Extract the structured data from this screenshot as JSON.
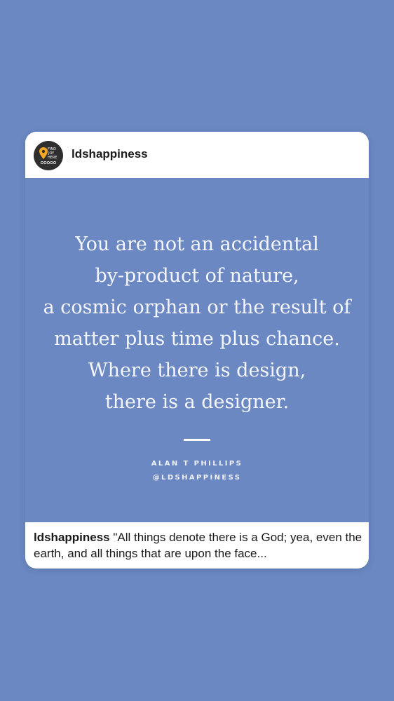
{
  "post": {
    "username": "ldshappiness",
    "avatar": {
      "icon": "map-pin-logo-icon",
      "text_lines": [
        "FIND",
        "JOY",
        "HERE"
      ],
      "colors": {
        "background": "#2f2f2f",
        "pin": "#f5a623"
      }
    },
    "quote_lines": [
      "You are not an accidental",
      "by-product of nature,",
      "a cosmic orphan or the result of",
      "matter plus time plus chance.",
      "Where there is design,",
      "there is a designer."
    ],
    "author": "ALAN T PHILLIPS",
    "handle": "@LDSHAPPINESS",
    "caption": {
      "username": "ldshappiness",
      "text": " \"All things denote there is a God; yea, even the earth, and all things that are upon the face..."
    }
  },
  "colors": {
    "background": "#6b88c2",
    "quote_text": "#f4f6fb",
    "card": "#ffffff"
  }
}
